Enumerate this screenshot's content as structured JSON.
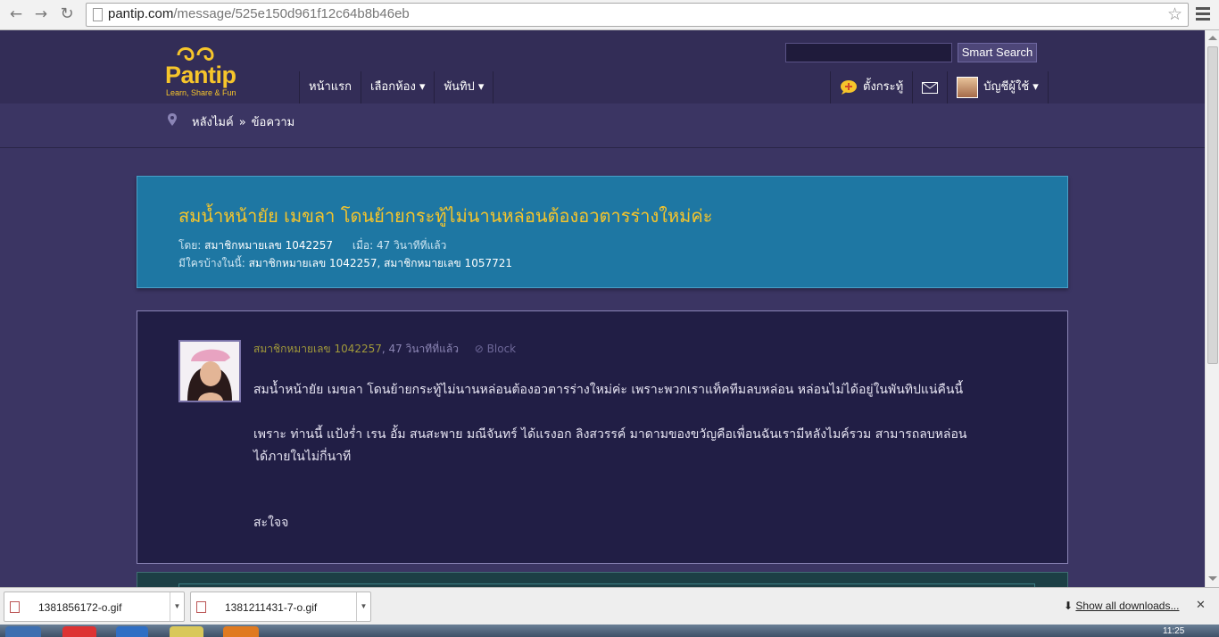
{
  "browser": {
    "url_host": "pantip.com",
    "url_path": "/message/525e150d961f12c64b8b46eb"
  },
  "header": {
    "logo_word": "Pantip",
    "logo_tagline": "Learn, Share & Fun",
    "search_button": "Smart Search",
    "nav": [
      {
        "label": "หน้าแรก"
      },
      {
        "label": "เลือกห้อง ▾"
      },
      {
        "label": "พันทิป ▾"
      }
    ],
    "post_topic": "ตั้งกระทู้",
    "account": "บัญชีผู้ใช้ ▾"
  },
  "breadcrumb": {
    "first": "หลังไมค์",
    "sep": "»",
    "current": "ข้อความ"
  },
  "message": {
    "title": "สมน้ำหน้ายัย เมขลา โดนย้ายกระทู้ไม่นานหล่อนต้องอวตารร่างใหม่ค่ะ",
    "by_label": "โดย:",
    "by_value": "สมาชิกหมายเลข 1042257",
    "when_label": "เมื่อ:",
    "when_value": "47 วินาทีที่แล้ว",
    "members_label": "มีใครบ้างในนี้:",
    "members_value": "สมาชิกหมายเลข 1042257, สมาชิกหมายเลข 1057721"
  },
  "post": {
    "author": "สมาชิกหมายเลข 1042257",
    "time": ", 47 วินาทีที่แล้ว",
    "block": "Block",
    "line1": "สมน้ำหน้ายัย เมขลา โดนย้ายกระทู้ไม่นานหล่อนต้องอวตารร่างใหม่ค่ะ เพราะพวกเราแท็คทีมลบหล่อน หล่อนไม่ได้อยู่ในพันทิปแน่คืนนี้",
    "line2": "เพราะ ท่านนี้ แป้งร่ำ เรน อั้ม สนสะพาย มณีจันทร์ ได้แรงอก ลิงสวรรค์ มาดามของขวัญคือเพื่อนฉันเรามีหลังไมค์รวม สามารถลบหล่อน",
    "line3": "ได้ภายในไม่กี่นาที",
    "line4": "สะใจจ"
  },
  "downloads": {
    "items": [
      {
        "name": "1381856172-o.gif"
      },
      {
        "name": "1381211431-7-o.gif"
      }
    ],
    "show_all": "Show all downloads..."
  },
  "taskbar": {
    "clock": "11:25"
  },
  "colors": {
    "page_bg": "#3b3563",
    "title_box": "#1e77a3",
    "accent_yellow": "#f6c52b",
    "post_bg": "#211e45"
  }
}
